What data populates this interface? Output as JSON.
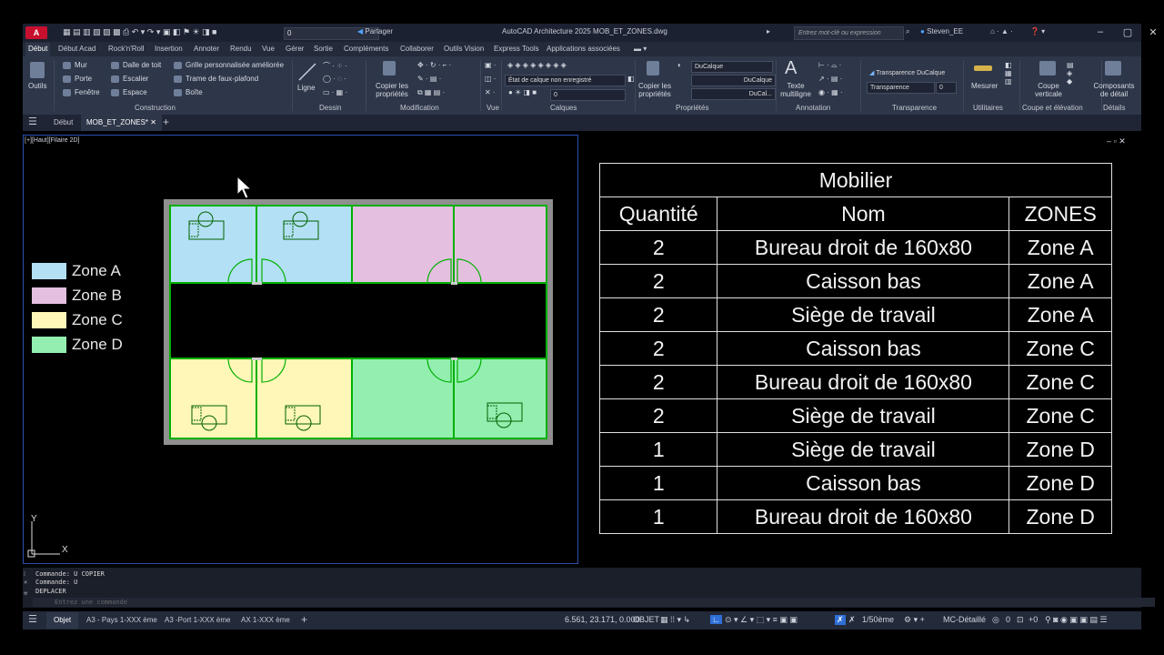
{
  "app": {
    "logo_text": "A",
    "title": "AutoCAD Architecture 2025    MOB_ET_ZONES.dwg",
    "share_label": "Partager",
    "layer_value": "0",
    "search_placeholder": "Entrez mot-clé ou expression",
    "user": "Steven_EE"
  },
  "ribbon_tabs": [
    "Début",
    "Début Acad",
    "Rock'n'Roll",
    "Insertion",
    "Annoter",
    "Rendu",
    "Vue",
    "Gérer",
    "Sortie",
    "Compléments",
    "Collaborer",
    "Outils Vision",
    "Express Tools",
    "Applications associées"
  ],
  "ribbon": {
    "outils": "Outils",
    "construction": {
      "mur": "Mur",
      "porte": "Porte",
      "fenetre": "Fenêtre",
      "dalle": "Dalle de toit",
      "escalier": "Escalier",
      "espace": "Espace",
      "grille": "Grille personnalisée améliorée",
      "trame": "Trame de faux-plafond",
      "boite": "Boîte",
      "label": "Construction"
    },
    "dessin": {
      "ligne": "Ligne",
      "label": "Dessin"
    },
    "modification": {
      "copier": "Copier les propriétés",
      "label": "Modification"
    },
    "vue": {
      "label": "Vue"
    },
    "calques": {
      "etat": "État de calque non enregistré",
      "layer": "0",
      "label": "Calques"
    },
    "proprietes": {
      "copier": "Copier les propriétés",
      "ducalque": "DuCalque",
      "ducalque2": "DuCalque",
      "ducal": "DuCal...",
      "label": "Propriétés"
    },
    "annotation": {
      "texte": "Texte multiligne",
      "label": "Annotation"
    },
    "transparence": {
      "combo": "Transparence DuCalque",
      "field": "Transparence",
      "value": "0",
      "label": "Transparence"
    },
    "utilitaires": {
      "mesurer": "Mesurer",
      "label": "Utilitaires"
    },
    "coupe": {
      "coupe": "Coupe verticale",
      "label": "Coupe et élévation"
    },
    "details": {
      "composants": "Composants de détail",
      "label": "Détails"
    }
  },
  "doc_tabs": {
    "debut": "Début",
    "active": "MOB_ET_ZONES*"
  },
  "viewport": {
    "label": "[+][Haut][Filaire 2D]",
    "ucs_x": "X",
    "ucs_y": "Y"
  },
  "colors": {
    "zone_a": "#b3e0f5",
    "zone_b": "#e4bfe0",
    "zone_c": "#fef7b8",
    "zone_d": "#93efb0",
    "wall": "#00c000"
  },
  "legend": [
    {
      "label": "Zone A",
      "color": "#b3e0f5"
    },
    {
      "label": "Zone B",
      "color": "#e4bfe0"
    },
    {
      "label": "Zone C",
      "color": "#fef7b8"
    },
    {
      "label": "Zone D",
      "color": "#93efb0"
    }
  ],
  "table": {
    "title": "Mobilier",
    "headers": [
      "Quantité",
      "Nom",
      "ZONES"
    ],
    "rows": [
      [
        "2",
        "Bureau droit de 160x80",
        "Zone A"
      ],
      [
        "2",
        "Caisson bas",
        "Zone A"
      ],
      [
        "2",
        "Siège de travail",
        "Zone A"
      ],
      [
        "2",
        "Caisson bas",
        "Zone C"
      ],
      [
        "2",
        "Bureau droit de 160x80",
        "Zone C"
      ],
      [
        "2",
        "Siège de travail",
        "Zone C"
      ],
      [
        "1",
        "Siège de travail",
        "Zone D"
      ],
      [
        "1",
        "Caisson bas",
        "Zone D"
      ],
      [
        "1",
        "Bureau droit de 160x80",
        "Zone D"
      ]
    ]
  },
  "command": {
    "lines": [
      "Commande: U COPIER",
      "Commande: U",
      "DEPLACER"
    ],
    "placeholder": "Entrez une commande"
  },
  "status": {
    "tabs": [
      "Objet",
      "A3 - Pays 1-XXX ème",
      "A3 -Port 1-XXX ème",
      "AX 1-XXX ème"
    ],
    "coords": "6.561, 23.171, 0.000",
    "objet": "OBJET",
    "scale": "1/50ème",
    "detail": "MC-Détaillé",
    "zero": "0",
    "plus": "+0"
  }
}
